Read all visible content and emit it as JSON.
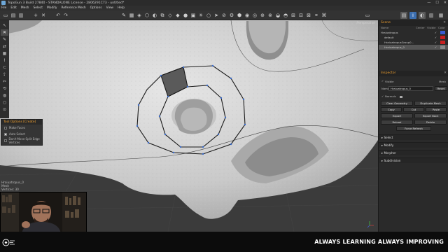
{
  "window": {
    "title": "TopoGun 3 Build 27840 - STANDALONE License - 2806291C73 - untitled*",
    "controls": [
      "—",
      "☐",
      "✕"
    ]
  },
  "menu": [
    "File",
    "Edit",
    "Mesh",
    "Select",
    "Modify",
    "Reference Mesh",
    "Options",
    "View",
    "Help"
  ],
  "viewport": {
    "camera_label": "Perspective"
  },
  "tool_options": {
    "header": "Tool Options [Create]",
    "options": [
      {
        "label": "Make Faces",
        "checked": false
      },
      {
        "label": "Auto Select",
        "checked": true
      },
      {
        "label": "Don't Move Split Edge Vertices",
        "checked": false
      }
    ]
  },
  "status": {
    "object": "Hraiuatropus_0",
    "mesh_label": "Mesh",
    "vertices_label": "Vertices: 30",
    "progress": 0.35
  },
  "scene": {
    "title": "Scene",
    "columns": [
      "Name",
      "Center",
      "Visible",
      "Color"
    ],
    "rows": [
      {
        "name": "Hraiuatropus",
        "color": "#3a5bd0",
        "selected": false
      },
      {
        "name": "default",
        "color": "#c82020",
        "selected": false
      },
      {
        "name": "HraiuatropusGroup0...",
        "color": "#c82020",
        "selected": false
      },
      {
        "name": "Hraiuatropus_0",
        "color": "#888888",
        "selected": true
      }
    ]
  },
  "inspector": {
    "title": "Inspector",
    "visible_label": "Visible",
    "mesh_label": "Mesh",
    "name_label": "Name",
    "name_value": "Hraiuatropus_0",
    "reset_label": "Reset",
    "normals_label": "Normals",
    "buttons": [
      [
        "Clear Geometry",
        "Duplicate Mesh"
      ],
      [
        "Copy",
        "Cut",
        "Paste"
      ],
      [
        "Export",
        "Export Back"
      ],
      [
        "Reload",
        "Delete"
      ]
    ],
    "force_refresh": "Force Refresh"
  },
  "sections": [
    "Select",
    "Modify",
    "Morpher",
    "Subdivision"
  ],
  "banner": {
    "slogan": "ALWAYS LEARNING ALWAYS IMPROVING"
  }
}
